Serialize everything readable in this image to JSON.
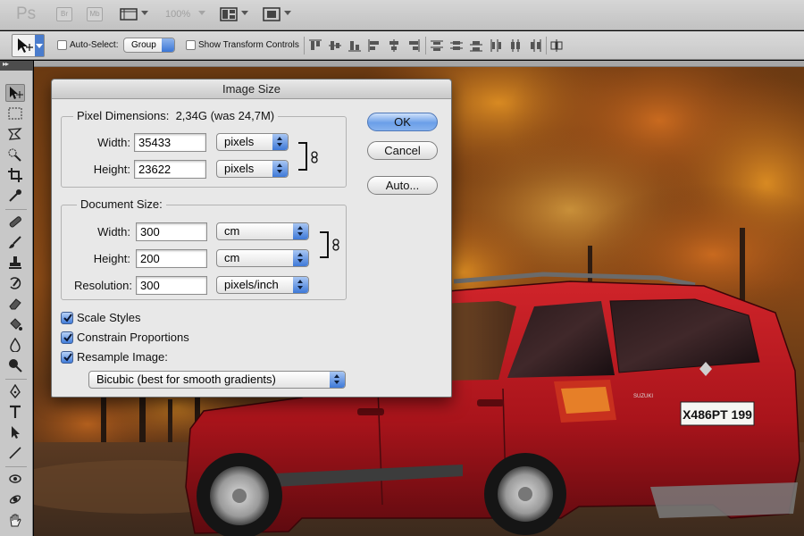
{
  "app": {
    "logo": "Ps",
    "bridge_label": "Br",
    "minibridge_label": "Mb",
    "zoom": "100%"
  },
  "options_bar": {
    "auto_select_label": "Auto-Select:",
    "auto_select_value": "Group",
    "show_transform_label": "Show Transform Controls"
  },
  "dialog": {
    "title": "Image Size",
    "pixel_dimensions": {
      "title": "Pixel Dimensions:",
      "size_text": "2,34G (was 24,7M)",
      "width_label": "Width:",
      "width_value": "35433",
      "width_unit": "pixels",
      "height_label": "Height:",
      "height_value": "23622",
      "height_unit": "pixels"
    },
    "document_size": {
      "title": "Document Size:",
      "width_label": "Width:",
      "width_value": "300",
      "width_unit": "cm",
      "height_label": "Height:",
      "height_value": "200",
      "height_unit": "cm",
      "resolution_label": "Resolution:",
      "resolution_value": "300",
      "resolution_unit": "pixels/inch"
    },
    "checkboxes": [
      {
        "label": "Scale Styles",
        "checked": true
      },
      {
        "label": "Constrain Proportions",
        "checked": true
      },
      {
        "label": "Resample Image:",
        "checked": true
      }
    ],
    "resample_method": "Bicubic (best for smooth gradients)",
    "buttons": {
      "ok": "OK",
      "cancel": "Cancel",
      "auto": "Auto..."
    }
  },
  "photo": {
    "license_plate": "X486PT 199",
    "car_badge": "SUZUKI"
  },
  "colors": {
    "accent_blue": "#3e79d8",
    "car_red": "#b8141a"
  }
}
